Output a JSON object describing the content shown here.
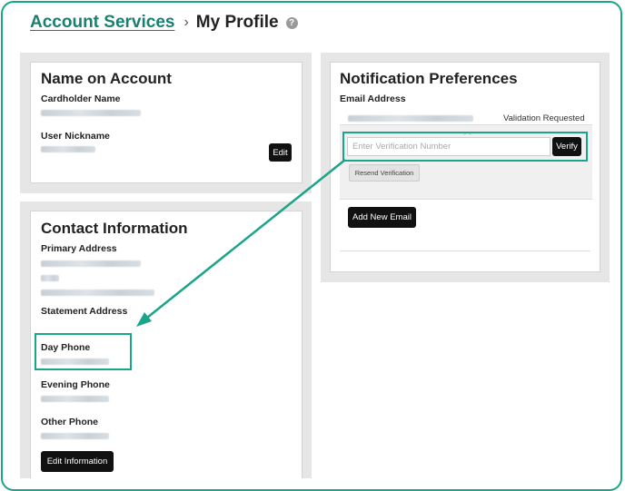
{
  "breadcrumb": {
    "parent": "Account Services",
    "separator": "›",
    "current": "My Profile",
    "help": "?"
  },
  "name_card": {
    "title": "Name on Account",
    "cardholder_label": "Cardholder Name",
    "nickname_label": "User Nickname",
    "edit_label": "Edit"
  },
  "notif_card": {
    "title": "Notification Preferences",
    "email_label": "Email Address",
    "status": "Validation Requested",
    "verify_placeholder": "Enter Verification Number",
    "verify_label": "Verify",
    "resend_label": "Resend Verification",
    "add_email_label": "Add New Email"
  },
  "contact_card": {
    "title": "Contact Information",
    "primary_label": "Primary Address",
    "statement_label": "Statement Address",
    "day_label": "Day Phone",
    "evening_label": "Evening Phone",
    "other_label": "Other Phone",
    "edit_info_label": "Edit Information"
  },
  "colors": {
    "accent": "#1aa58a",
    "link": "#1a7f70",
    "button": "#111111"
  }
}
